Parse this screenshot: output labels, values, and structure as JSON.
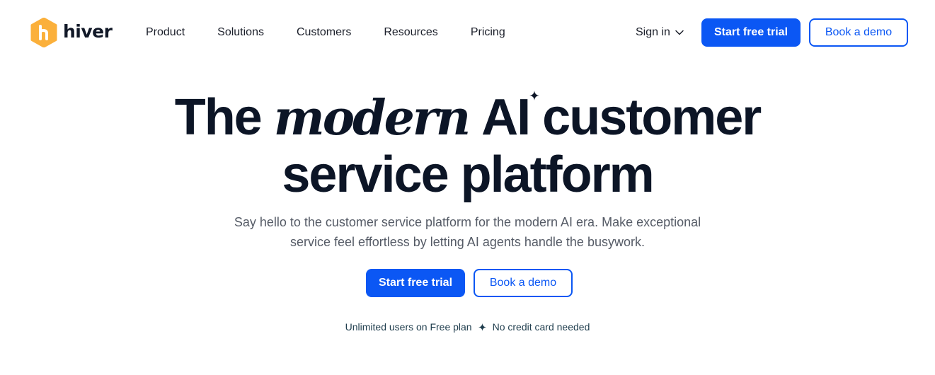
{
  "header": {
    "logo_text": "hiver",
    "nav": [
      "Product",
      "Solutions",
      "Customers",
      "Resources",
      "Pricing"
    ],
    "sign_in_label": "Sign in",
    "trial_button": "Start free trial",
    "demo_button": "Book a demo"
  },
  "hero": {
    "headline": {
      "part1": "The",
      "part2": "modern",
      "part3": "AI",
      "part4": "customer",
      "line2": "service platform"
    },
    "subtitle_line1": "Say hello to the customer service platform for the modern AI era. Make exceptional",
    "subtitle_line2": "service feel effortless by letting AI agents handle the busywork.",
    "trial_button": "Start free trial",
    "demo_button": "Book a demo",
    "footnote_left": "Unlimited users on Free plan",
    "footnote_right": "No credit card needed"
  },
  "icons": {
    "logo": "hiver-logo-icon",
    "sign_in_caret": "chevron-down-icon",
    "headline_accent": "sparkle-icon",
    "footnote_separator": "sparkle-icon"
  },
  "colors": {
    "brand_blue": "#0b57f4",
    "logo_orange": "#fbb03b",
    "headline_text": "#0c1526",
    "body_text": "#555b66"
  }
}
